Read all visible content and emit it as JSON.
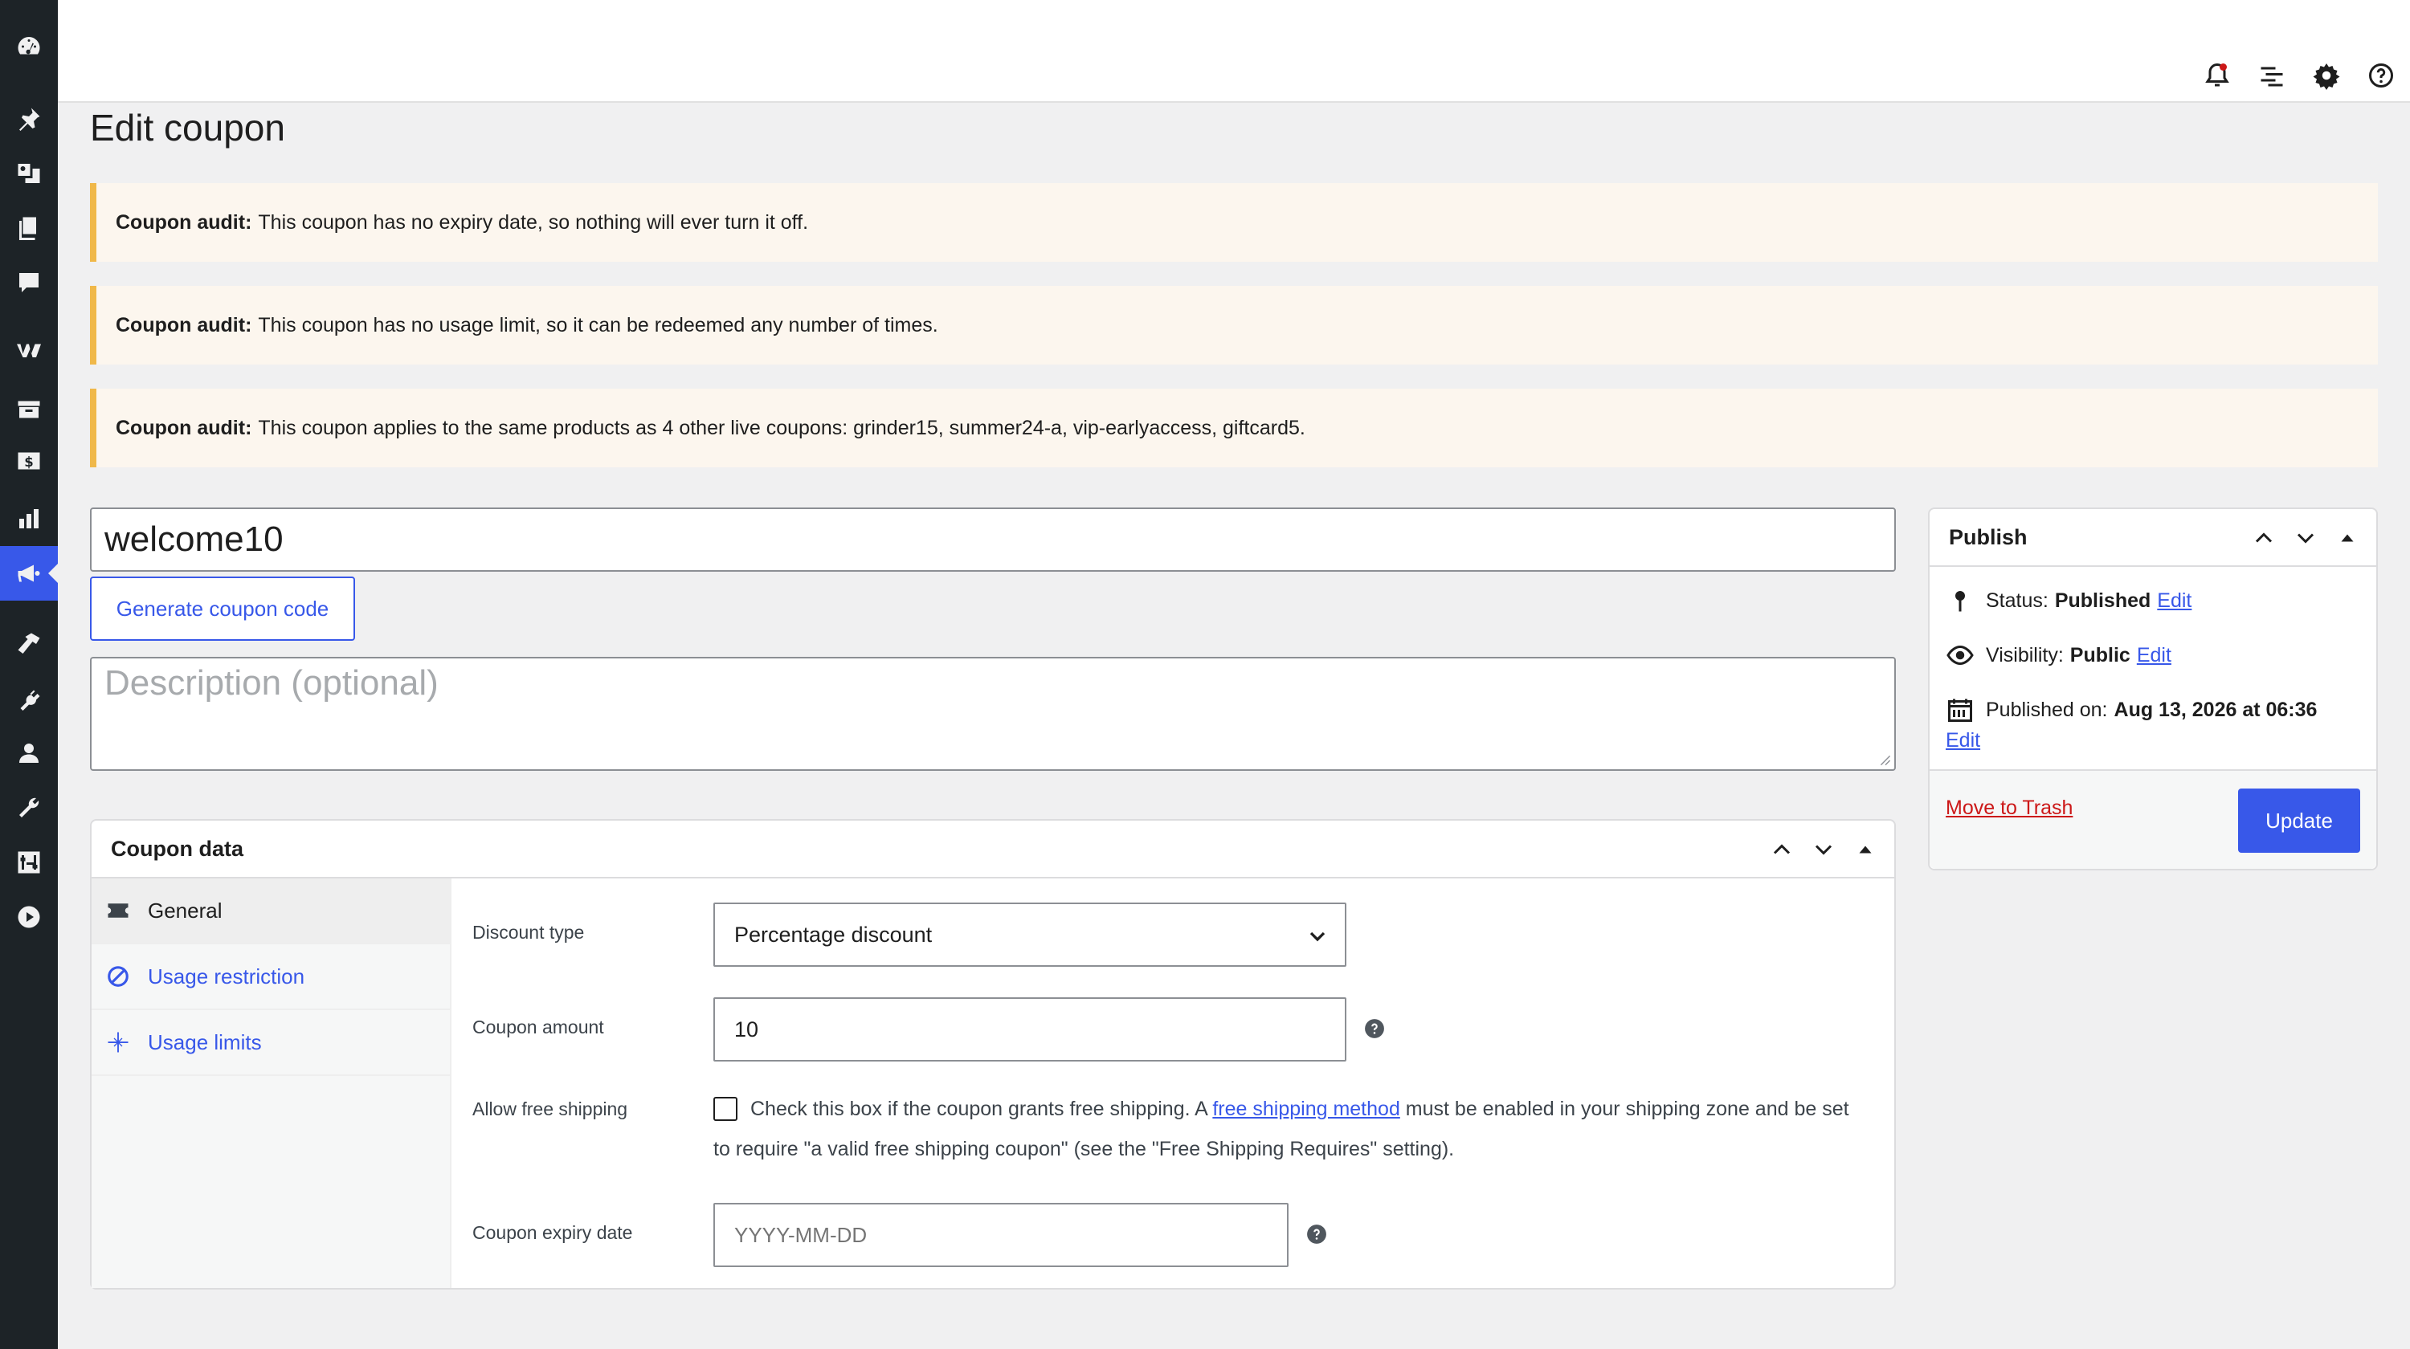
{
  "page": {
    "title": "Edit coupon"
  },
  "sidebar": {
    "icons": [
      "dashboard-icon",
      "pin-icon",
      "media-icon",
      "pages-icon",
      "comments-icon",
      "woocommerce-icon",
      "products-icon",
      "payments-icon",
      "analytics-icon",
      "marketing-icon",
      "appearance-icon",
      "plugins-icon",
      "users-icon",
      "tools-icon",
      "settings-icon",
      "play-icon"
    ],
    "active": "marketing-icon"
  },
  "topbar": {
    "icons": [
      "notifications-icon",
      "activity-list-icon",
      "gear-icon",
      "help-icon"
    ]
  },
  "notices": [
    {
      "label": "Coupon audit:",
      "text": "This coupon has no expiry date, so nothing will ever turn it off."
    },
    {
      "label": "Coupon audit:",
      "text": "This coupon has no usage limit, so it can be redeemed any number of times."
    },
    {
      "label": "Coupon audit:",
      "text": "This coupon applies to the same products as 4 other live coupons: grinder15, summer24-a, vip-earlyaccess, giftcard5."
    }
  ],
  "coupon": {
    "code": "welcome10",
    "generate_label": "Generate coupon code",
    "description_placeholder": "Description (optional)"
  },
  "coupon_data": {
    "title": "Coupon data",
    "tabs": [
      {
        "label": "General",
        "icon": "ticket-icon"
      },
      {
        "label": "Usage restriction",
        "icon": "restriction-icon"
      },
      {
        "label": "Usage limits",
        "icon": "limits-icon"
      }
    ],
    "fields": {
      "discount_type_label": "Discount type",
      "discount_type_value": "Percentage discount",
      "amount_label": "Coupon amount",
      "amount_value": "10",
      "free_shipping_label": "Allow free shipping",
      "free_shipping_text_before": "Check this box if the coupon grants free shipping. A ",
      "free_shipping_link": "free shipping method",
      "free_shipping_text_after": " must be enabled in your shipping zone and be set to require \"a valid free shipping coupon\" (see the \"Free Shipping Requires\" setting).",
      "expiry_label": "Coupon expiry date",
      "expiry_placeholder": "YYYY-MM-DD"
    }
  },
  "publish": {
    "title": "Publish",
    "status_label": "Status:",
    "status_value": "Published",
    "visibility_label": "Visibility:",
    "visibility_value": "Public",
    "published_label": "Published on:",
    "published_value": "Aug 13, 2026 at 06:36",
    "edit_label": "Edit",
    "trash_label": "Move to Trash",
    "update_label": "Update"
  },
  "colors": {
    "accent": "#3858e9",
    "notice_border": "#f0b849",
    "danger": "#cc1818",
    "sidebar": "#1d2327"
  }
}
